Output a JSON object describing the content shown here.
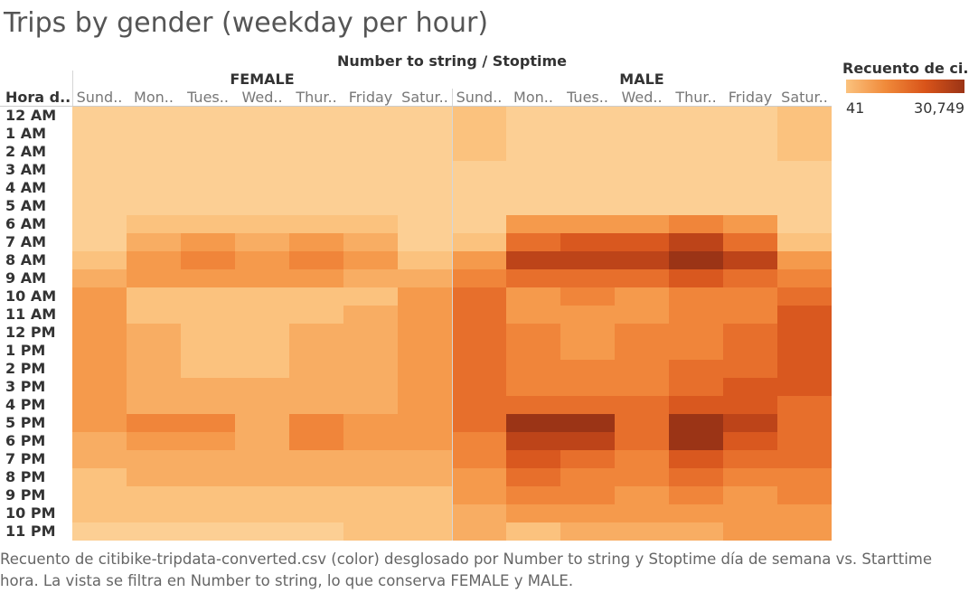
{
  "title": "Trips by gender (weekday per hour)",
  "legend": {
    "title": "Recuento de ci..",
    "min_label": "41",
    "max_label": "30,749"
  },
  "caption": "Recuento de citibike-tripdata-converted.csv (color) desglosado por Number to string y Stoptime día de semana vs. Starttime hora. La vista se filtra en Number to string, lo que conserva FEMALE y MALE.",
  "colors": [
    "#fccf94",
    "#fbc27e",
    "#f8ad63",
    "#f59a4c",
    "#f0853a",
    "#e76f2c",
    "#d9581f",
    "#bd4419",
    "#9b3416"
  ],
  "chart_data": {
    "type": "heatmap",
    "title": "Trips by gender (weekday per hour)",
    "column_header": "Number to string  /  Stoptime",
    "row_header": "Hora d..",
    "groups": [
      "FEMALE",
      "MALE"
    ],
    "day_labels": [
      "Sund..",
      "Mon..",
      "Tues..",
      "Wed..",
      "Thur..",
      "Friday",
      "Satur.."
    ],
    "days": [
      "Sunday",
      "Monday",
      "Tuesday",
      "Wednesday",
      "Thursday",
      "Friday",
      "Saturday"
    ],
    "hours": [
      "12 AM",
      "1 AM",
      "2 AM",
      "3 AM",
      "4 AM",
      "5 AM",
      "6 AM",
      "7 AM",
      "8 AM",
      "9 AM",
      "10 AM",
      "11 AM",
      "12 PM",
      "1 PM",
      "2 PM",
      "3 PM",
      "4 PM",
      "5 PM",
      "6 PM",
      "7 PM",
      "8 PM",
      "9 PM",
      "10 PM",
      "11 PM"
    ],
    "color_range": [
      41,
      30749
    ],
    "values": {
      "FEMALE": [
        [
          1800,
          400,
          400,
          400,
          400,
          500,
          700
        ],
        [
          1600,
          300,
          300,
          300,
          300,
          400,
          600
        ],
        [
          1300,
          200,
          200,
          200,
          200,
          300,
          500
        ],
        [
          900,
          150,
          150,
          150,
          150,
          200,
          400
        ],
        [
          600,
          150,
          150,
          150,
          150,
          200,
          300
        ],
        [
          500,
          800,
          800,
          800,
          800,
          800,
          400
        ],
        [
          800,
          3800,
          4200,
          4000,
          4000,
          3500,
          700
        ],
        [
          2000,
          8000,
          8500,
          8000,
          8600,
          7200,
          2200
        ],
        [
          4200,
          11000,
          12000,
          11000,
          13000,
          10000,
          4600
        ],
        [
          6500,
          9500,
          9500,
          8500,
          9500,
          8000,
          6800
        ],
        [
          8500,
          5200,
          4800,
          4800,
          5200,
          5200,
          9000
        ],
        [
          9200,
          5200,
          5000,
          4500,
          5000,
          5500,
          10000
        ],
        [
          9500,
          5500,
          5000,
          5000,
          5500,
          6000,
          10500
        ],
        [
          10000,
          5800,
          5000,
          5000,
          6000,
          6500,
          10500
        ],
        [
          10000,
          5800,
          5200,
          5200,
          6000,
          7000,
          10000
        ],
        [
          9500,
          6000,
          6000,
          5500,
          6500,
          7000,
          10000
        ],
        [
          9200,
          7500,
          7500,
          6500,
          7500,
          8000,
          9500
        ],
        [
          8500,
          12000,
          12000,
          8000,
          12500,
          10000,
          9200
        ],
        [
          7500,
          11500,
          11500,
          7500,
          12000,
          10000,
          8500
        ],
        [
          6000,
          8000,
          8000,
          7000,
          8000,
          7500,
          7000
        ],
        [
          4500,
          6500,
          6500,
          6000,
          6500,
          6000,
          5500
        ],
        [
          3500,
          4500,
          5000,
          4500,
          5000,
          4500,
          4500
        ],
        [
          3000,
          3500,
          3500,
          3500,
          3500,
          3500,
          3500
        ],
        [
          2200,
          2000,
          2200,
          2000,
          2200,
          2500,
          3000
        ]
      ],
      "MALE": [
        [
          4500,
          1500,
          1400,
          1500,
          1500,
          1800,
          3500
        ],
        [
          3800,
          700,
          700,
          700,
          700,
          900,
          3000
        ],
        [
          3000,
          400,
          400,
          400,
          400,
          500,
          2500
        ],
        [
          2200,
          300,
          300,
          300,
          300,
          400,
          1800
        ],
        [
          1500,
          300,
          300,
          300,
          300,
          400,
          1000
        ],
        [
          1000,
          1500,
          1600,
          1600,
          1600,
          1500,
          800
        ],
        [
          1800,
          9000,
          10000,
          10000,
          12000,
          9000,
          1500
        ],
        [
          4200,
          19000,
          20000,
          20000,
          23000,
          19000,
          4000
        ],
        [
          8500,
          24000,
          25000,
          25000,
          28000,
          23000,
          9500
        ],
        [
          12500,
          19000,
          19000,
          18500,
          21000,
          17500,
          13500
        ],
        [
          15500,
          11500,
          12000,
          11500,
          13000,
          13000,
          17500
        ],
        [
          17000,
          11500,
          11500,
          11500,
          13500,
          14000,
          19500
        ],
        [
          17500,
          12000,
          11500,
          12500,
          14500,
          15500,
          20500
        ],
        [
          17500,
          12500,
          11500,
          12000,
          15000,
          16500,
          20500
        ],
        [
          17500,
          13000,
          12500,
          12000,
          16000,
          18000,
          20000
        ],
        [
          17500,
          14500,
          14500,
          13500,
          17000,
          19500,
          19500
        ],
        [
          17000,
          17500,
          18000,
          15500,
          20000,
          21000,
          19000
        ],
        [
          16000,
          27000,
          27000,
          18000,
          30749,
          25000,
          18000
        ],
        [
          14500,
          26000,
          25500,
          17000,
          30000,
          21000,
          17000
        ],
        [
          12500,
          20000,
          19000,
          14500,
          22000,
          17000,
          15500
        ],
        [
          11000,
          15500,
          15000,
          13000,
          16500,
          14500,
          14000
        ],
        [
          9500,
          12000,
          12000,
          10500,
          13000,
          11500,
          12000
        ],
        [
          8000,
          9000,
          9000,
          8500,
          9500,
          9500,
          10000
        ],
        [
          6500,
          5000,
          6500,
          6500,
          7500,
          8500,
          9000
        ]
      ]
    }
  }
}
